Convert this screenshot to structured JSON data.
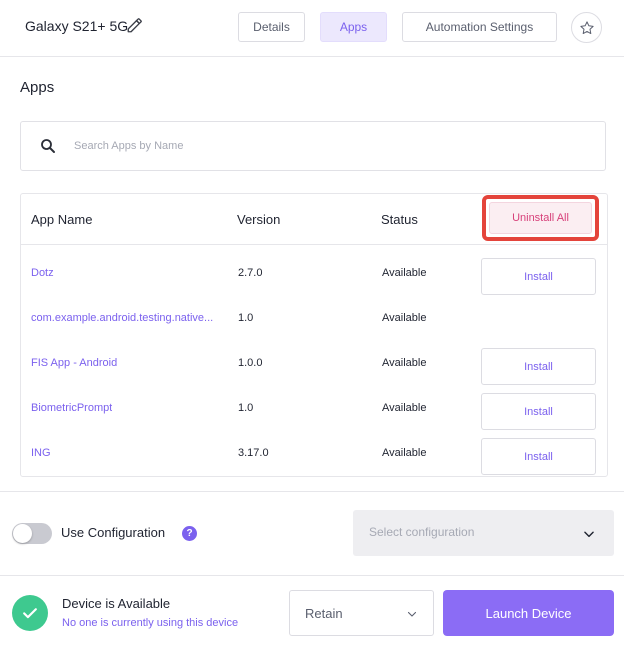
{
  "header": {
    "device_name": "Galaxy S21+ 5G",
    "tabs": [
      {
        "label": "Details"
      },
      {
        "label": "Apps"
      },
      {
        "label": "Automation Settings"
      }
    ]
  },
  "apps": {
    "title": "Apps",
    "search_placeholder": "Search Apps by Name",
    "columns": [
      "App Name",
      "Version",
      "Status"
    ],
    "uninstall_all_label": "Uninstall All",
    "rows": [
      {
        "name": "Dotz",
        "version": "2.7.0",
        "status": "Available",
        "action": "Install"
      },
      {
        "name": "com.example.android.testing.native...",
        "version": "1.0",
        "status": "Available",
        "action": ""
      },
      {
        "name": "FIS App - Android",
        "version": "1.0.0",
        "status": "Available",
        "action": "Install"
      },
      {
        "name": "BiometricPrompt",
        "version": "1.0",
        "status": "Available",
        "action": "Install"
      },
      {
        "name": "ING",
        "version": "3.17.0",
        "status": "Available",
        "action": "Install"
      }
    ]
  },
  "configuration": {
    "label": "Use Configuration",
    "help_icon": "?",
    "select_placeholder": "Select configuration"
  },
  "footer": {
    "status_title": "Device is Available",
    "status_subtitle": "No one is currently using this device",
    "retain_value": "Retain",
    "launch_label": "Launch Device"
  },
  "colors": {
    "accent": "#7b61ee",
    "launch_button": "#8b6cf5",
    "available_green": "#3ec98f",
    "highlight_red": "#e4443b"
  },
  "icons": {
    "edit": "pencil-icon",
    "favorite": "star-icon",
    "search": "search-icon",
    "dropdown": "chevron-down-icon",
    "status": "check-icon"
  }
}
